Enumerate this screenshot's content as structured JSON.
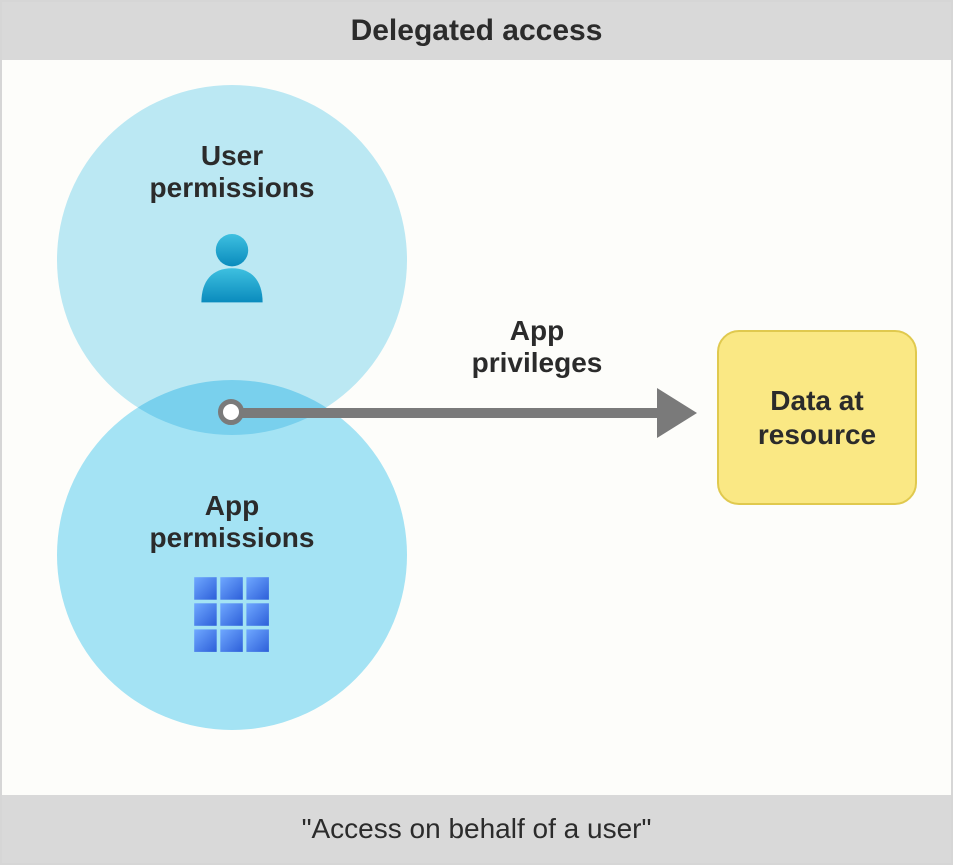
{
  "title": "Delegated access",
  "subtitle": "\"Access on behalf of a user\"",
  "venn": {
    "user_label": "User\npermissions",
    "app_label": "App\npermissions"
  },
  "arrow_label": "App\nprivileges",
  "resource_label": "Data at\nresource",
  "icons": {
    "user": "person-icon",
    "app": "grid-icon"
  },
  "colors": {
    "circle_user": "#bdeaf8",
    "circle_app": "#a5e5f9",
    "resource_bg": "#fae884",
    "resource_border": "#e0c94e",
    "arrow": "#7a7a7a",
    "header_bg": "#d9d9d9"
  }
}
